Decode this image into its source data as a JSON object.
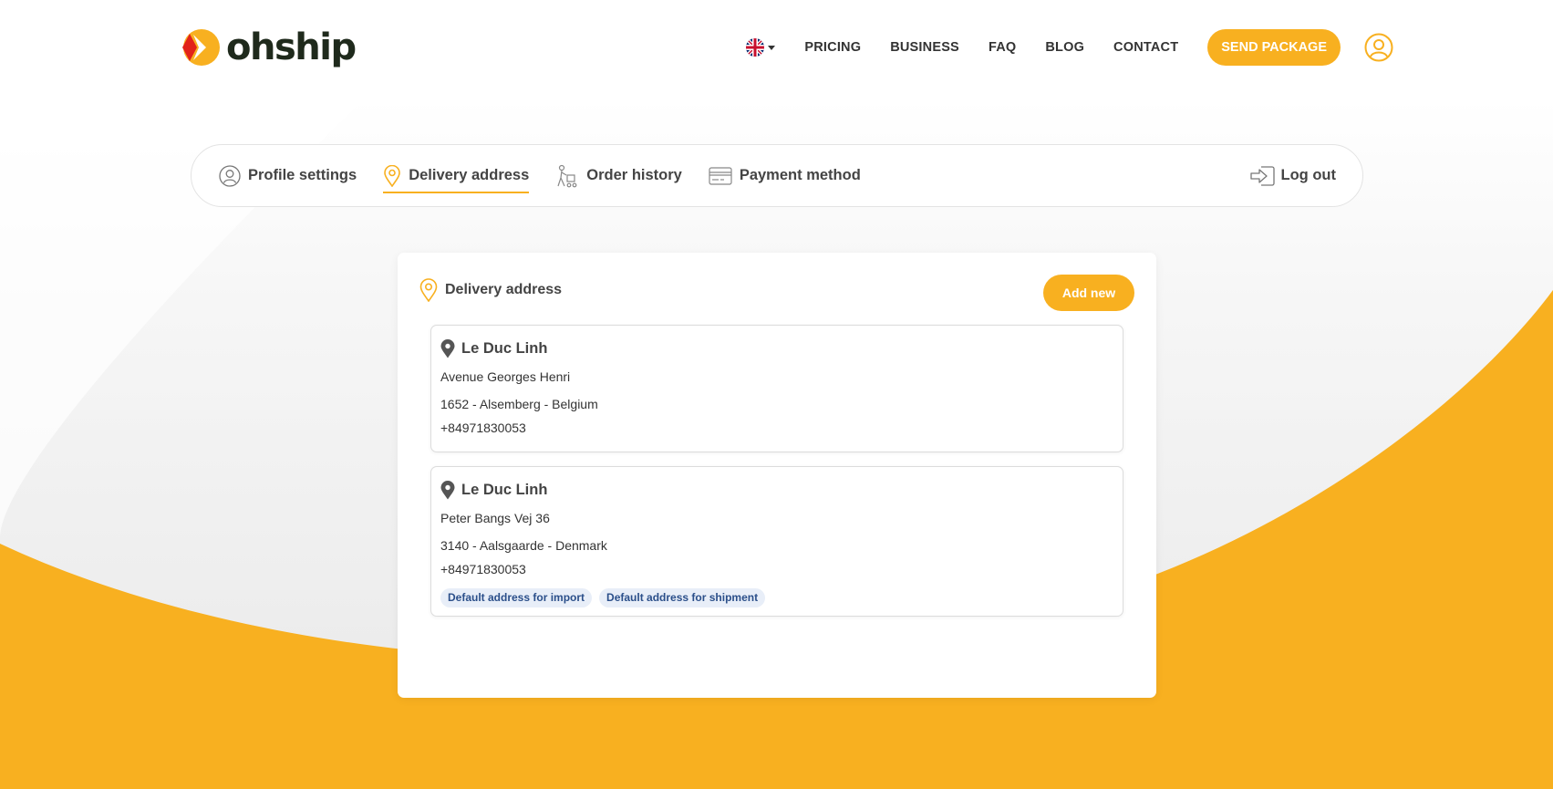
{
  "header": {
    "logo_text": "ohship",
    "language_flag": "uk-flag-icon",
    "nav": [
      "PRICING",
      "BUSINESS",
      "FAQ",
      "BLOG",
      "CONTACT"
    ],
    "send_package_label": "SEND PACKAGE",
    "user_icon": "user-icon"
  },
  "tabs": {
    "items": [
      {
        "label": "Profile settings",
        "icon": "user-icon",
        "active": false
      },
      {
        "label": "Delivery address",
        "icon": "location-pin-icon",
        "active": true
      },
      {
        "label": "Order history",
        "icon": "delivery-person-icon",
        "active": false
      },
      {
        "label": "Payment method",
        "icon": "credit-card-icon",
        "active": false
      }
    ],
    "logout_label": "Log out"
  },
  "delivery": {
    "title": "Delivery address",
    "add_new_label": "Add new",
    "addresses": [
      {
        "name": "Le Duc Linh",
        "street": "Avenue Georges Henri",
        "city_line": "1652 - Alsemberg - Belgium",
        "phone": "+84971830053",
        "badges": []
      },
      {
        "name": "Le Duc Linh",
        "street": "Peter Bangs Vej 36",
        "city_line": "3140 - Aalsgaarde - Denmark",
        "phone": "+84971830053",
        "badges": [
          "Default address for import",
          "Default address for shipment"
        ]
      }
    ]
  },
  "colors": {
    "accent": "#f8b020",
    "logo_red": "#e2231a",
    "text_dark": "#333333",
    "badge_bg": "#e8eef8",
    "badge_text": "#2b4f8a"
  }
}
